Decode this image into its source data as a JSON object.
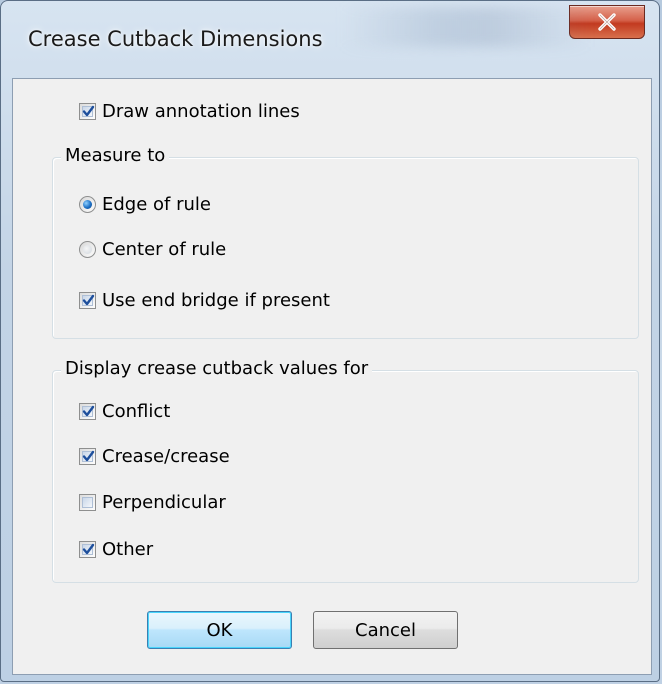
{
  "window": {
    "title": "Crease Cutback Dimensions",
    "close_label": "X"
  },
  "options": {
    "draw_annotation_lines": {
      "label": "Draw annotation lines",
      "checked": true
    }
  },
  "measure_to": {
    "title": "Measure to",
    "edge_of_rule": {
      "label": "Edge of rule",
      "selected": true
    },
    "center_of_rule": {
      "label": "Center of rule",
      "selected": false
    },
    "use_end_bridge": {
      "label": "Use end bridge if present",
      "checked": true
    }
  },
  "display_values": {
    "title": "Display crease cutback values for",
    "items": [
      {
        "label": "Conflict",
        "checked": true
      },
      {
        "label": "Crease/crease",
        "checked": true
      },
      {
        "label": "Perpendicular",
        "checked": false
      },
      {
        "label": "Other",
        "checked": true
      }
    ]
  },
  "buttons": {
    "ok_label": "OK",
    "cancel_label": "Cancel"
  },
  "colors": {
    "accent_check": "#1e4f9c",
    "radio_selected": "#1c6fc4",
    "default_button_border": "#3c7fb1",
    "close_button": "#c23a20"
  }
}
